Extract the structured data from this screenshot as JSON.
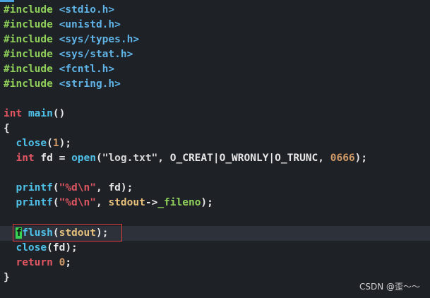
{
  "editor": {
    "lines": [
      {
        "pre": "#include",
        "hdr": "<stdio.h>"
      },
      {
        "pre": "#include",
        "hdr": "<unistd.h>"
      },
      {
        "pre": "#include",
        "hdr": "<sys/types.h>"
      },
      {
        "pre": "#include",
        "hdr": "<sys/stat.h>"
      },
      {
        "pre": "#include",
        "hdr": "<fcntl.h>"
      },
      {
        "pre": "#include",
        "hdr": "<string.h>"
      }
    ],
    "main_sig": {
      "type": "int",
      "name": "main",
      "parens": "()"
    },
    "open_brace": "{",
    "close_call": {
      "fn": "close",
      "arg": "1",
      "tail": ");"
    },
    "open_line": {
      "type": "int",
      "decl": "fd =",
      "fn": "open",
      "str": "\"log.txt\"",
      "flags": ", O_CREAT|O_WRONLY|O_TRUNC, ",
      "num": "0666",
      "tail": ");"
    },
    "printf1": {
      "fn": "printf",
      "fmt": "\"%d\\n\"",
      "rest": ", fd);"
    },
    "printf2": {
      "fn": "printf",
      "fmt": "\"%d\\n\"",
      "stdout": "stdout",
      "arrow": "->",
      "member": "_fileno",
      "tail": ");"
    },
    "fflush": {
      "cursor": "f",
      "fn": "flush",
      "open": "(",
      "stdout": "stdout",
      "tail": ");"
    },
    "close_fd": {
      "fn": "close",
      "rest": "(fd);"
    },
    "return_line": {
      "kw": "return",
      "num": "0",
      "tail": ";"
    },
    "close_brace": "}"
  },
  "watermark": "CSDN @歪～～",
  "colors": {
    "background": "#1e2227",
    "highlight_border": "#e03b3b",
    "cursor": "#39d353"
  }
}
